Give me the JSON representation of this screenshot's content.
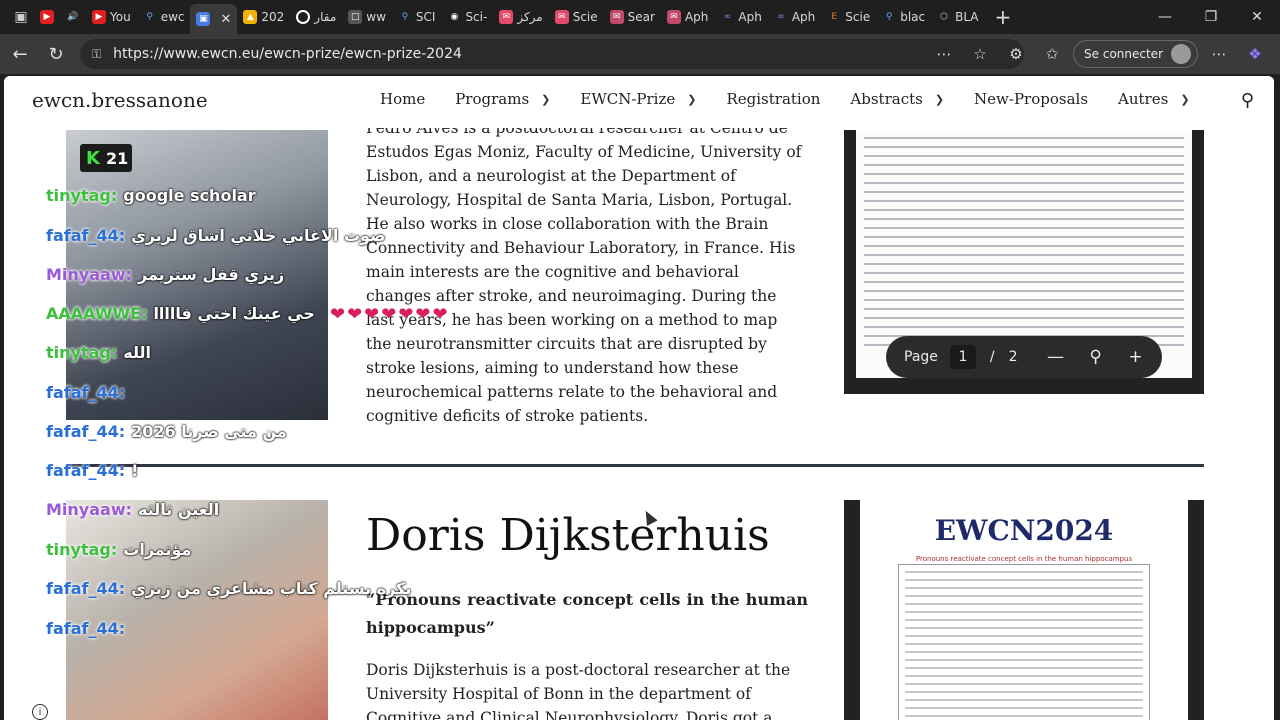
{
  "browser": {
    "tabs": [
      {
        "label": "",
        "color": "#e02020"
      },
      {
        "label": "",
        "color": "#cfcfcf"
      },
      {
        "label": "You",
        "color": "#e02020"
      },
      {
        "label": "ewc",
        "color": "#4a7be0"
      },
      {
        "label": "202",
        "color": "#f0b400"
      },
      {
        "label": "مقار",
        "color": "#ffffff"
      },
      {
        "label": "ww",
        "color": "#bdbdbd"
      },
      {
        "label": "SCI",
        "color": "#6aa0ff"
      },
      {
        "label": "Sci-",
        "color": "#ffffff"
      },
      {
        "label": "مركز",
        "color": "#e64a6a"
      },
      {
        "label": "Scie",
        "color": "#e64a6a"
      },
      {
        "label": "Sear",
        "color": "#c04a6a"
      },
      {
        "label": "Aph",
        "color": "#c04a6a"
      },
      {
        "label": "Aph",
        "color": "#3a6ac0"
      },
      {
        "label": "Aph",
        "color": "#3a6ac0"
      },
      {
        "label": "Scie",
        "color": "#b05a2a"
      },
      {
        "label": "blac",
        "color": "#6aa0ff"
      },
      {
        "label": "BLA",
        "color": "#cfcfcf"
      }
    ],
    "url": "https://www.ewcn.eu/ewcn-prize/ewcn-prize-2024",
    "signin_label": "Se connecter"
  },
  "site": {
    "brand": "ewcn.bressanone",
    "menu": [
      {
        "label": "Home",
        "has_dropdown": false
      },
      {
        "label": "Programs",
        "has_dropdown": true
      },
      {
        "label": "EWCN-Prize",
        "has_dropdown": true
      },
      {
        "label": "Registration",
        "has_dropdown": false
      },
      {
        "label": "Abstracts",
        "has_dropdown": true
      },
      {
        "label": "New-Proposals",
        "has_dropdown": false
      },
      {
        "label": "Autres",
        "has_dropdown": true
      }
    ]
  },
  "person1": {
    "bio": "Pedro Alves is a postdoctoral researcher at Centro de Estudos Egas Moniz, Faculty of Medicine, University of Lisbon, and a neurologist at the Department of Neurology, Hospital de Santa Maria, Lisbon, Portugal. He also works in close collaboration with the Brain Connectivity and Behaviour Laboratory, in France. His main interests are the cognitive and behavioral changes after stroke, and neuroimaging. During the last years, he has been working on a method to map the neurotransmitter circuits that are disrupted by stroke lesions, aiming to understand how these neurochemical patterns relate to the behavioral and cognitive deficits of stroke patients."
  },
  "pdf_viewer": {
    "page_label": "Page",
    "current_page": "1",
    "separator": "/",
    "total_pages": "2"
  },
  "person2": {
    "name": "Doris Dijksterhuis",
    "talk_title": "“Pronouns reactivate concept cells in the human hippocampus”",
    "bio": "Doris Dijksterhuis is a post-doctoral researcher at the University Hospital of Bonn in the department of Cognitive and Clinical Neurophysiology. Doris got a",
    "poster_heading": "EWCN2024",
    "poster_subtitle": "Pronouns reactivate concept cells in the human hippocampus"
  },
  "overlay": {
    "badge_count": "21",
    "badge_letter": "K",
    "messages": [
      {
        "user": "tinytag:",
        "text": "google scholar",
        "color": "#3fbf3f"
      },
      {
        "user": "fafaf_44:",
        "text": "صوت الاغاني خلاني اشاق لزيزي",
        "color": "#2a6fd8"
      },
      {
        "user": "Minyaaw:",
        "text": "زيزي قفل ستريمر",
        "color": "#9b5ad6"
      },
      {
        "user": "AAAAWWE:",
        "text": "حي عينك اختي فااااا",
        "color": "#3fbf3f"
      },
      {
        "user": "tinytag:",
        "text": "الله",
        "color": "#3fbf3f"
      },
      {
        "user": "fafaf_44:",
        "text": "",
        "color": "#2a6fd8"
      },
      {
        "user": "fafaf_44:",
        "text": "من متى صرنا 2026",
        "color": "#2a6fd8"
      },
      {
        "user": "fafaf_44:",
        "text": "!",
        "color": "#2a6fd8"
      },
      {
        "user": "Minyaaw:",
        "text": "العين ثالثه",
        "color": "#9b5ad6"
      },
      {
        "user": "tinytag:",
        "text": "مؤتمرات",
        "color": "#3fbf3f"
      },
      {
        "user": "fafaf_44:",
        "text": "بكره بستلم كتاب مشاعري من زيزي",
        "color": "#2a6fd8"
      },
      {
        "user": "fafaf_44:",
        "text": "",
        "color": "#2a6fd8"
      }
    ]
  }
}
